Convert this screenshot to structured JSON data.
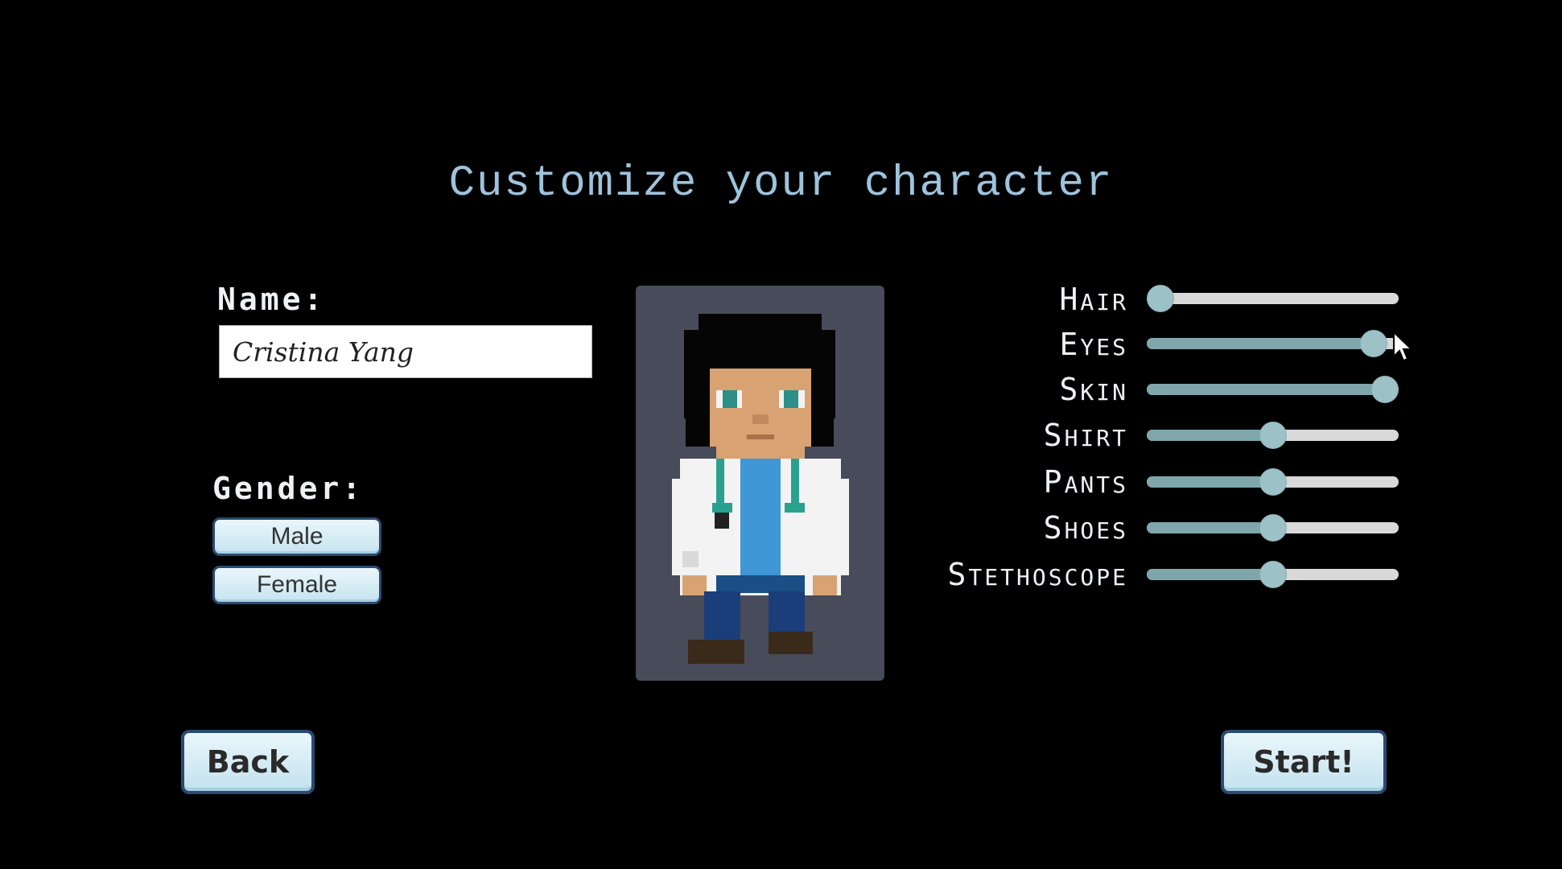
{
  "title": "Customize your character",
  "name_section": {
    "label": "Name:",
    "value": "Cristina Yang"
  },
  "gender_section": {
    "label": "Gender:",
    "male_label": "Male",
    "female_label": "Female"
  },
  "sliders": {
    "hair": {
      "label": "Hair",
      "value": 0.0
    },
    "eyes": {
      "label": "Eyes",
      "value": 0.95
    },
    "skin": {
      "label": "Skin",
      "value": 1.0
    },
    "shirt": {
      "label": "Shirt",
      "value": 0.5
    },
    "pants": {
      "label": "Pants",
      "value": 0.5
    },
    "shoes": {
      "label": "Shoes",
      "value": 0.5
    },
    "stethoscope": {
      "label": "Stethoscope",
      "value": 0.5
    }
  },
  "buttons": {
    "back_label": "Back",
    "start_label": "Start!"
  },
  "colors": {
    "background": "#000000",
    "title": "#9ec3dc",
    "portrait_bg": "#484b59",
    "slider_fill": "#7fa7ab",
    "slider_track": "#d9d9d9",
    "button_border": "#2a4a70"
  }
}
